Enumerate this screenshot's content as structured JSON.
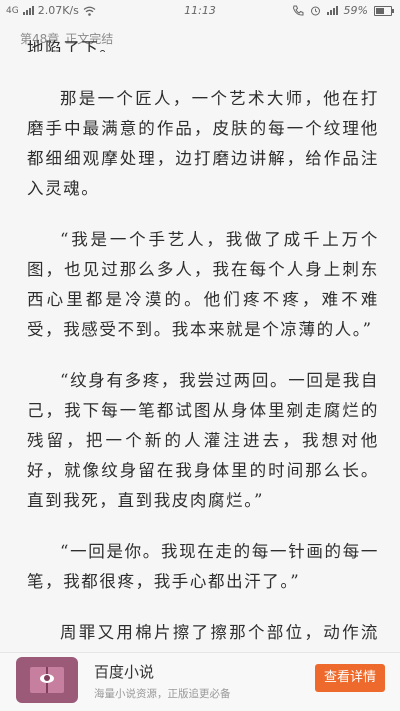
{
  "status_bar": {
    "network": "4G",
    "speed": "2.07K/s",
    "time": "11:13",
    "battery": "59%",
    "battery_level": 0.59
  },
  "header": {
    "chapter": "第48章",
    "chapter_title": "正文完结"
  },
  "content": {
    "cut_line": "地陷了下。",
    "paragraphs": [
      "那是一个匠人，一个艺术大师，他在打磨手中最满意的作品，皮肤的每一个纹理他都细细观摩处理，边打磨边讲解，给作品注入灵魂。",
      "“我是一个手艺人，我做了成千上万个图，也见过那么多人，我在每个人身上刺东西心里都是冷漠的。他们疼不疼，难不难受，我感受不到。我本来就是个凉薄的人。”",
      "“纹身有多疼，我尝过两回。一回是我自己，我下每一笔都试图从身体里剜走腐烂的残留，把一个新的人灌注进去，我想对他好，就像纹身留在我身体里的时间那么长。直到我死，直到我皮肉腐烂。”",
      "“一回是你。我现在走的每一针画的每一笔，我都很疼，我手心都出汗了。”",
      "周罪又用棉片擦了擦那个部位，动作流畅"
    ]
  },
  "ad": {
    "app_name": "百度小说",
    "description": "海量小说资源，正版追更必备",
    "button_label": "查看详情"
  }
}
